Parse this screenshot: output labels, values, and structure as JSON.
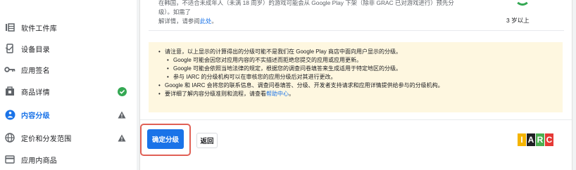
{
  "sidebar": {
    "items": [
      {
        "label": "软件工件库",
        "icon": "library-icon",
        "active": false,
        "status": null
      },
      {
        "label": "设备目录",
        "icon": "devices-icon",
        "active": false,
        "status": null
      },
      {
        "label": "应用签名",
        "icon": "key-icon",
        "active": false,
        "status": null
      },
      {
        "label": "商品详情",
        "icon": "store-icon",
        "active": false,
        "status": "complete"
      },
      {
        "label": "内容分级",
        "icon": "rating-icon",
        "active": true,
        "status": "warning"
      },
      {
        "label": "定价和分发范围",
        "icon": "globe-icon",
        "active": false,
        "status": "warning"
      },
      {
        "label": "应用内商品",
        "icon": "credit-card-icon",
        "active": false,
        "status": null
      }
    ]
  },
  "rating_row": {
    "text_line1": "在韩国，不适合未成年人（未满 18 周岁）的游戏可能会从 Google Play 下架（除非 GRAC 已对游戏进行）预先分级）。如需了",
    "text_line2_prefix": "解详情，请参阅",
    "text_line2_link": "此处",
    "text_line2_suffix": "。",
    "age_rating": "3 岁以上"
  },
  "notice": {
    "item1": "请注意，以上显示的计算得出的分级可能不是我们在 Google Play 商店中面向用户显示的分级。",
    "item1_sub1": "Google 可能会因您对应用内容的不实描述而拒绝您提交的应用或应用更新。",
    "item1_sub2": "Google 可能会依照当地法律的规定，根据您的调查问卷填答来生成适用于特定地区的分级。",
    "item1_sub3": "参与 IARC 的分级机构可以在审核您的应用分级后对其进行更改。",
    "item2": "Google 和 IARC 会将您的联系信息、调查问卷填答、分级、开发者支持请求和应用详情提供给参与的分级机构。",
    "item3_prefix": "要详细了解内容分级准则和流程，请查看",
    "item3_link": "帮助中心",
    "item3_suffix": "。"
  },
  "actions": {
    "confirm_label": "确定分级",
    "back_label": "返回"
  },
  "logo": {
    "letters": [
      "I",
      "A",
      "R",
      "C"
    ],
    "colors": [
      "#f5b400",
      "#202124",
      "#4caf50",
      "#e53935"
    ]
  },
  "colors": {
    "accent": "#1a73e8",
    "complete": "#34a853",
    "warning": "#5f6368",
    "notice_bg": "#fef7e0",
    "highlight": "#e06055"
  }
}
